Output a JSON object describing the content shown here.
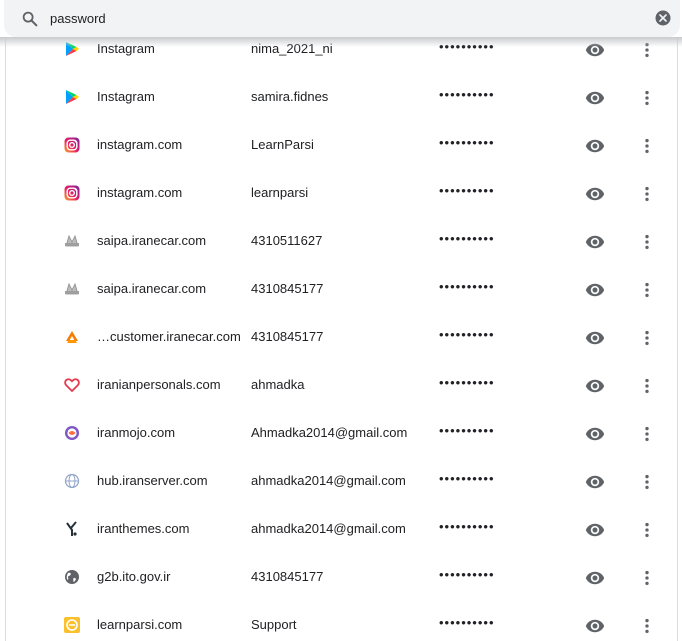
{
  "search": {
    "query": "password"
  },
  "colors": {
    "search_background": "#f1f3f4",
    "icon_gray": "#5f6368",
    "text": "#202124"
  },
  "passwords": [
    {
      "site": "Instagram",
      "username": "nima_2021_ni",
      "password_mask": "••••••••••",
      "icon": "play-store-icon"
    },
    {
      "site": "Instagram",
      "username": "samira.fidnes",
      "password_mask": "••••••••••",
      "icon": "play-store-icon"
    },
    {
      "site": "instagram.com",
      "username": "LearnParsi",
      "password_mask": "••••••••••",
      "icon": "instagram-icon"
    },
    {
      "site": "instagram.com",
      "username": "learnparsi",
      "password_mask": "••••••••••",
      "icon": "instagram-icon"
    },
    {
      "site": "saipa.iranecar.com",
      "username": "4310511627",
      "password_mask": "••••••••••",
      "icon": "saipa-icon"
    },
    {
      "site": "saipa.iranecar.com",
      "username": "4310845177",
      "password_mask": "••••••••••",
      "icon": "saipa-icon"
    },
    {
      "site": "…customer.iranecar.com",
      "username": "4310845177",
      "password_mask": "••••••••••",
      "icon": "iranecar-logo-icon"
    },
    {
      "site": "iranianpersonals.com",
      "username": "ahmadka",
      "password_mask": "••••••••••",
      "icon": "heart-icon"
    },
    {
      "site": "iranmojo.com",
      "username": "Ahmadka2014@gmail.com",
      "password_mask": "••••••••••",
      "icon": "iranmojo-icon"
    },
    {
      "site": "hub.iranserver.com",
      "username": "ahmadka2014@gmail.com",
      "password_mask": "••••••••••",
      "icon": "globe-ring-icon"
    },
    {
      "site": "iranthemes.com",
      "username": "ahmadka2014@gmail.com",
      "password_mask": "••••••••••",
      "icon": "iranthemes-icon"
    },
    {
      "site": "g2b.ito.gov.ir",
      "username": "4310845177",
      "password_mask": "••••••••••",
      "icon": "globe-icon"
    },
    {
      "site": "learnparsi.com",
      "username": "Support",
      "password_mask": "••••••••••",
      "icon": "learnparsi-icon"
    }
  ]
}
